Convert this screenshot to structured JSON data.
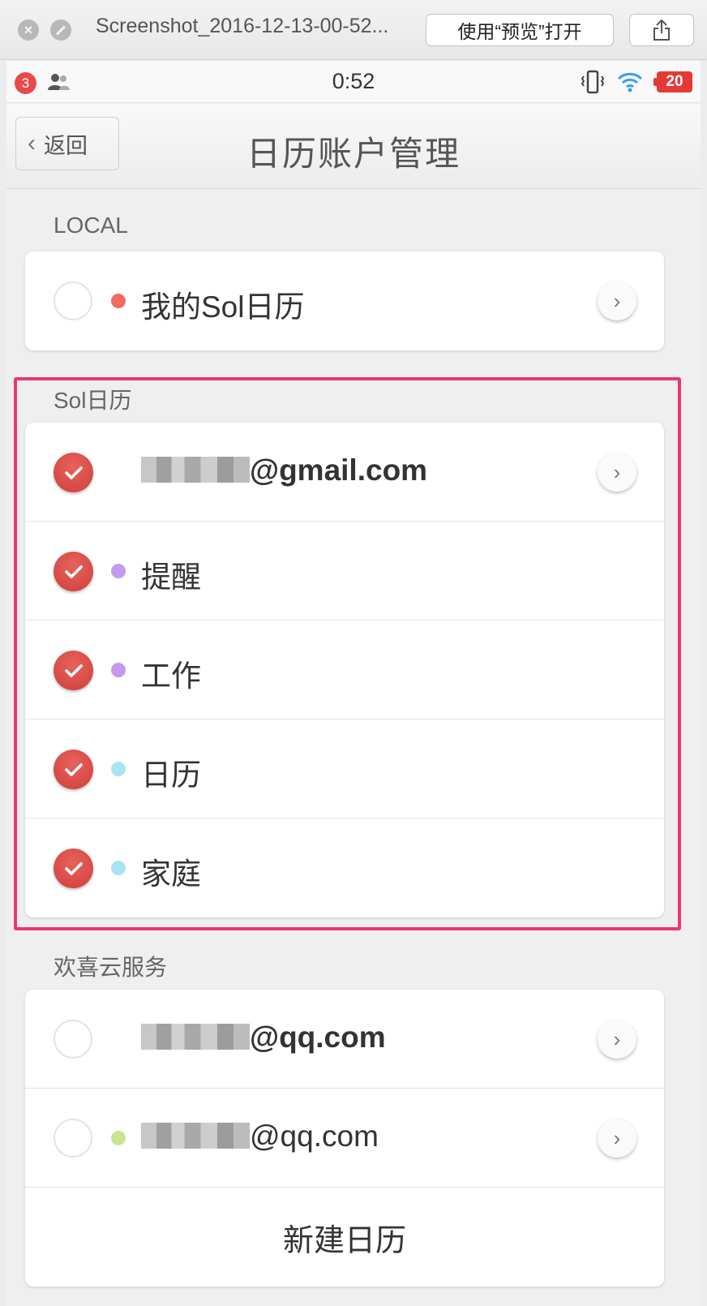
{
  "window": {
    "title": "Screenshot_2016-12-13-00-52...",
    "open_with_preview": "使用“预览”打开"
  },
  "status": {
    "notification_count": "3",
    "time": "0:52",
    "battery": "20"
  },
  "nav": {
    "back_label": "返回",
    "title": "日历账户管理"
  },
  "sections": {
    "local": {
      "header": "LOCAL",
      "items": [
        {
          "label": "我的Sol日历",
          "checked": false,
          "dot_color": "#f26b5f",
          "has_chevron": true
        }
      ]
    },
    "sol": {
      "header": "Sol日历",
      "account_suffix": "@gmail.com",
      "items": [
        {
          "label": "提醒",
          "checked": true,
          "dot_color": "#c49af0"
        },
        {
          "label": "工作",
          "checked": true,
          "dot_color": "#c49af0"
        },
        {
          "label": "日历",
          "checked": true,
          "dot_color": "#a6e4f0"
        },
        {
          "label": "家庭",
          "checked": true,
          "dot_color": "#a6e4f0"
        }
      ]
    },
    "huanxi": {
      "header": "欢喜云服务",
      "account1_suffix": "@qq.com",
      "account2_suffix": "@qq.com",
      "account2_dot_color": "#c8e68c",
      "new_calendar": "新建日历"
    }
  },
  "colors": {
    "check_red": "#d9463f",
    "highlight_pink": "#e8386f"
  }
}
